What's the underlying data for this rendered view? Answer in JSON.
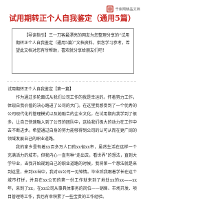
{
  "site": {
    "logo_text": "千库网精品文档"
  },
  "title": "试用期转正个人自我鉴定（通用5篇）",
  "guide": "【导读指引】三一刀客最漂亮的网友为您整理分享的“试用期转正个人自我鉴定（通用5篇）”文档资料，供您学习参考，希望此文档对您有所帮助，喜欢就分享给朋友们吧！",
  "article": {
    "heading": "试用期转正个人自我鉴定【第一篇】",
    "paragraphs": [
      "作为通过多轮面试从我们公司工作的我是幸运的。怀着努力工作，体现自我价值的决心踏进了公司的大门。在这里我感受到了一个优秀的公司现代化的管理模式以及她融合的企业文化，在试用期内我学到了很多，让自己快速融入到了公司的团队中，这给我们极大的动力在工作中去不断进步。希望通过自身的努力能够得到公司的认可从而在更广阔的领域发展自己的职业道路。",
      "我的家乡是有着xx百多万人口的xx省xx市，虽然生活在这样一个充满活力的城市，但我内心一直有种“走出去，看世界”的想法，直到大学毕业，当我开始规划自己的职业道路的时候，我将第一个想法就是来到这里，来到xx当中，我对xx公司一见钟情。毕业后我跟着学长在这个城市打拼，并且在xx公司的第一份工作就来到了地处xx的xx——xx年，来到了xx，在xx公司从事具体事务的岗位——销售、市场开发、项目管理等工作，我也有幸积累了一些宝贵的工作经验。"
    ]
  }
}
